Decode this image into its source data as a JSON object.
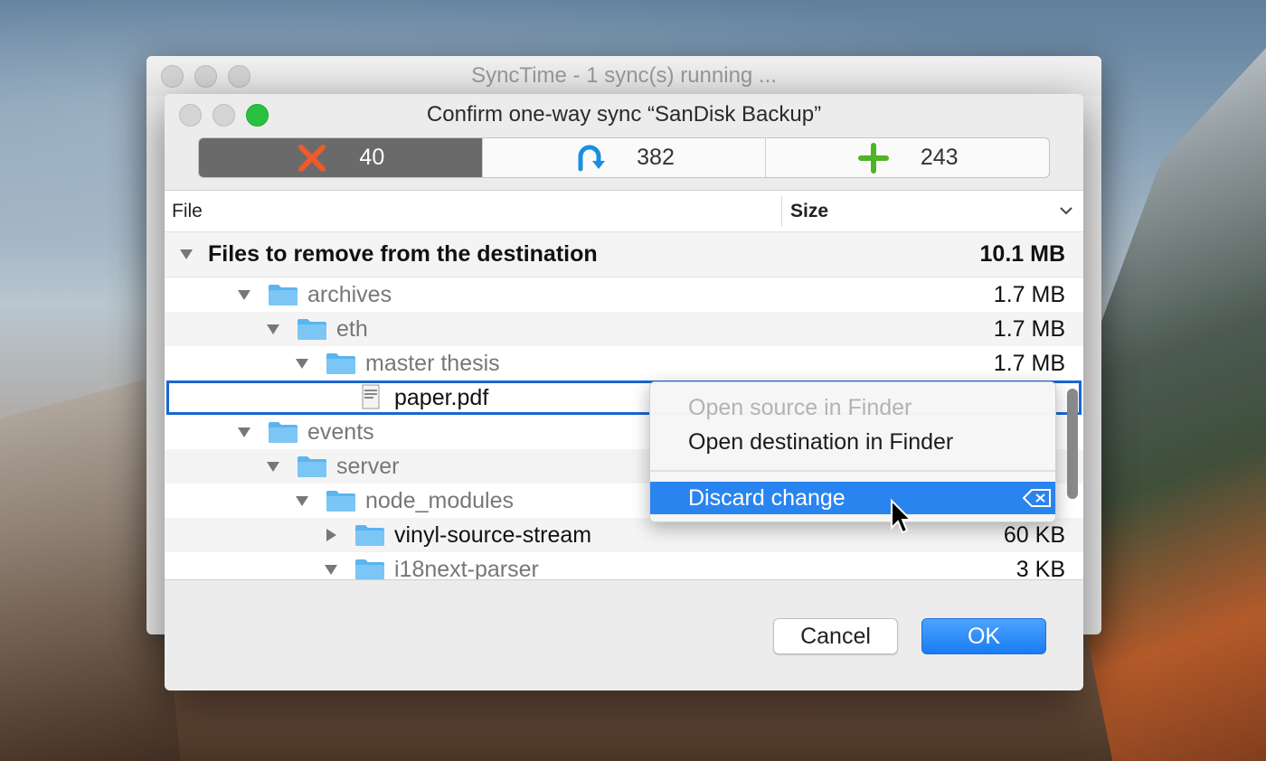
{
  "back_window": {
    "title": "SyncTime - 1 sync(s) running ..."
  },
  "dialog": {
    "title": "Confirm one-way sync “SanDisk Backup”",
    "segments": [
      {
        "icon": "remove-x-icon",
        "count": "40",
        "color": "#e8522a"
      },
      {
        "icon": "update-arrow-icon",
        "count": "382",
        "color": "#1a8fe0"
      },
      {
        "icon": "add-plus-icon",
        "count": "243",
        "color": "#4caf20"
      }
    ],
    "columns": {
      "file": "File",
      "size": "Size"
    },
    "group": {
      "label": "Files to remove from the destination",
      "size": "10.1 MB"
    },
    "rows": [
      {
        "name": "archives",
        "size": "1.7 MB",
        "type": "folder",
        "expanded": true
      },
      {
        "name": "eth",
        "size": "1.7 MB",
        "type": "folder",
        "expanded": true
      },
      {
        "name": "master thesis",
        "size": "1.7 MB",
        "type": "folder",
        "expanded": true
      },
      {
        "name": "paper.pdf",
        "size": "",
        "type": "file"
      },
      {
        "name": "events",
        "size": "",
        "type": "folder",
        "expanded": true
      },
      {
        "name": "server",
        "size": "",
        "type": "folder",
        "expanded": true
      },
      {
        "name": "node_modules",
        "size": "",
        "type": "folder",
        "expanded": true
      },
      {
        "name": "vinyl-source-stream",
        "size": "60 KB",
        "type": "folder",
        "expanded": false
      },
      {
        "name": "i18next-parser",
        "size": "3 KB",
        "type": "folder",
        "expanded": true
      }
    ],
    "buttons": {
      "cancel": "Cancel",
      "ok": "OK"
    }
  },
  "context_menu": {
    "items": [
      {
        "label": "Open source in Finder",
        "state": "disabled"
      },
      {
        "label": "Open destination in Finder",
        "state": "normal"
      },
      {
        "label": "Discard change",
        "state": "highlighted",
        "shortcut_icon": "delete-key-icon"
      }
    ]
  },
  "colors": {
    "accent": "#2a84f0",
    "folder": "#5ab4f0"
  }
}
